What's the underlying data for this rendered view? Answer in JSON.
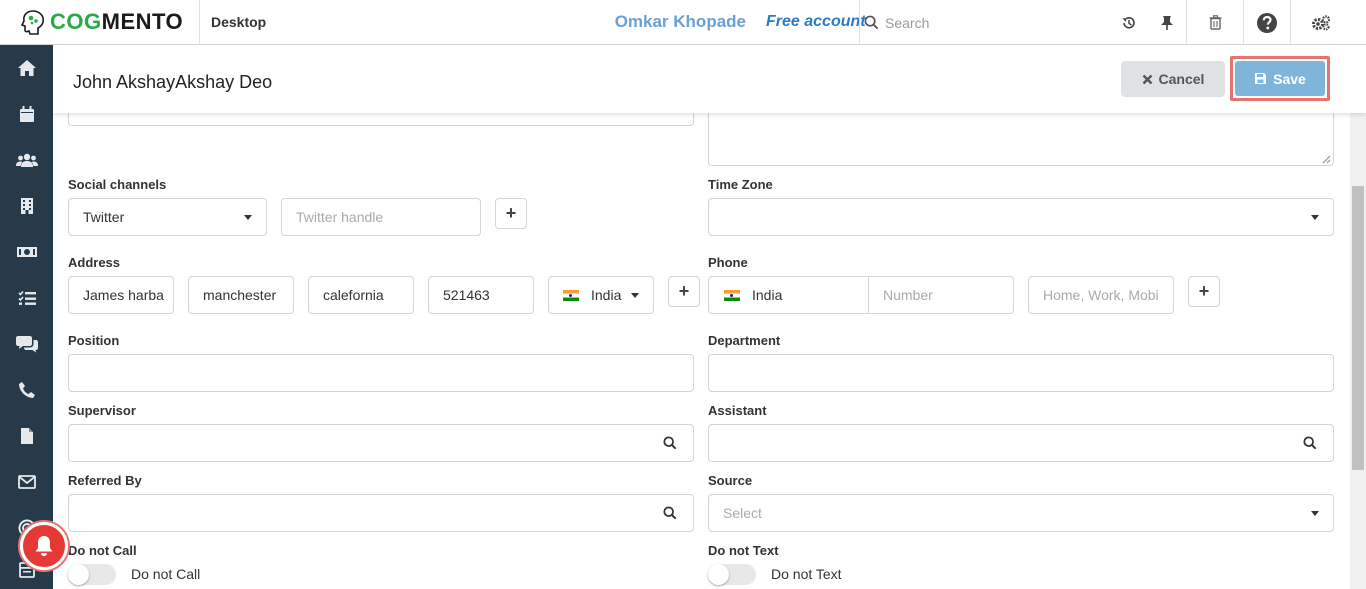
{
  "app": {
    "logo_cog": "COG",
    "logo_mento": "MENTO",
    "workspace": "Desktop",
    "user_name": "Omkar Khopade",
    "account_type": "Free account",
    "search_placeholder": "Search"
  },
  "header": {
    "title": "John AkshayAkshay Deo",
    "cancel_label": "Cancel",
    "save_label": "Save"
  },
  "sidebar": {
    "items": [
      "home-icon",
      "calendar-icon",
      "contacts-icon",
      "companies-icon",
      "deals-icon",
      "tasks-icon",
      "cases-icon",
      "calls-icon",
      "documents-icon",
      "email-icon",
      "campaigns-icon",
      "forms-icon"
    ]
  },
  "form": {
    "social": {
      "label": "Social channels",
      "channel": "Twitter",
      "handle_placeholder": "Twitter handle"
    },
    "timezone": {
      "label": "Time Zone",
      "value": ""
    },
    "address": {
      "label": "Address",
      "street": "James harba",
      "city": "manchester",
      "state": "calefornia",
      "zip": "521463",
      "country": "India"
    },
    "phone": {
      "label": "Phone",
      "country": "India",
      "number_placeholder": "Number",
      "type_placeholder": "Home, Work, Mobi"
    },
    "position": {
      "label": "Position",
      "value": ""
    },
    "department": {
      "label": "Department",
      "value": ""
    },
    "supervisor": {
      "label": "Supervisor",
      "value": ""
    },
    "assistant": {
      "label": "Assistant",
      "value": ""
    },
    "referred_by": {
      "label": "Referred By",
      "value": ""
    },
    "source": {
      "label": "Source",
      "placeholder": "Select"
    },
    "do_not_call": {
      "label": "Do not Call",
      "toggle_label": "Do not Call",
      "enabled": false
    },
    "do_not_text": {
      "label": "Do not Text",
      "toggle_label": "Do not Text",
      "enabled": false
    }
  },
  "colors": {
    "brand_green": "#2ba84a",
    "sidebar_bg": "#263a4a",
    "save_bg": "#7fb5db",
    "save_highlight": "#e57373",
    "user_name": "#6aa0d8",
    "account": "#2a7bc8"
  }
}
